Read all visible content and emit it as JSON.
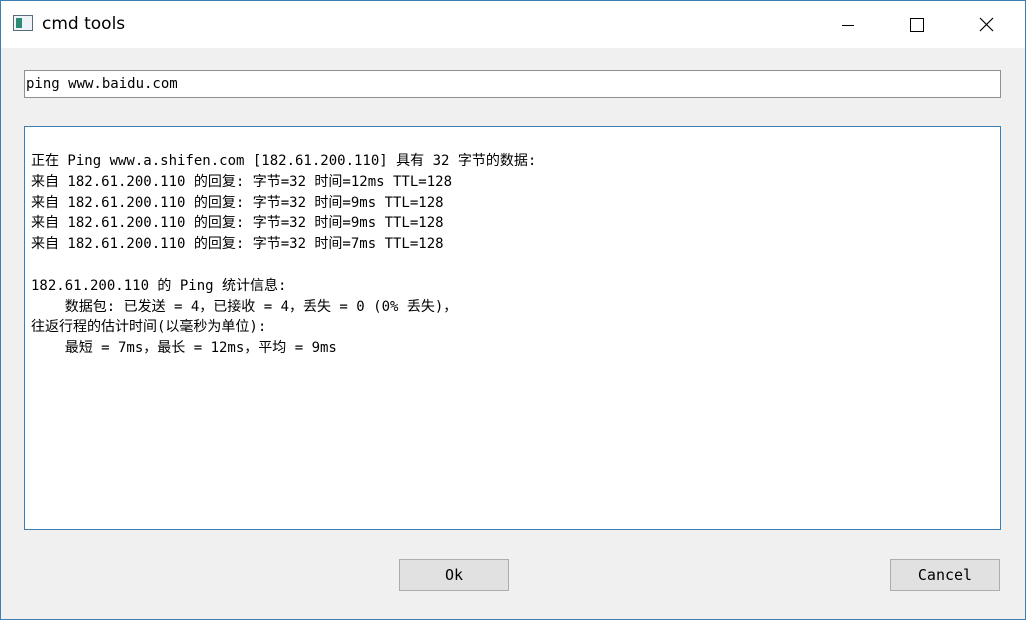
{
  "window": {
    "title": "cmd tools",
    "controls": [
      "minimize",
      "maximize",
      "close"
    ]
  },
  "command_input": {
    "value": "ping www.baidu.com"
  },
  "output": {
    "lines": [
      "正在 Ping www.a.shifen.com [182.61.200.110] 具有 32 字节的数据:",
      "来自 182.61.200.110 的回复: 字节=32 时间=12ms TTL=128",
      "来自 182.61.200.110 的回复: 字节=32 时间=9ms TTL=128",
      "来自 182.61.200.110 的回复: 字节=32 时间=9ms TTL=128",
      "来自 182.61.200.110 的回复: 字节=32 时间=7ms TTL=128",
      "",
      "182.61.200.110 的 Ping 统计信息:",
      "    数据包: 已发送 = 4，已接收 = 4，丢失 = 0 (0% 丢失)，",
      "往返行程的估计时间(以毫秒为单位):",
      "    最短 = 7ms，最长 = 12ms，平均 = 9ms"
    ]
  },
  "buttons": {
    "ok_label": "Ok",
    "cancel_label": "Cancel"
  }
}
